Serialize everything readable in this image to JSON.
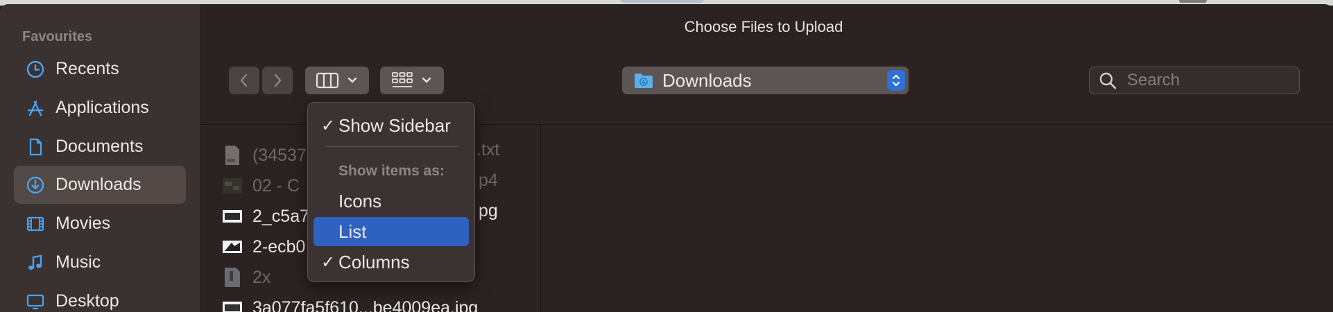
{
  "dialog": {
    "title": "Choose Files to Upload"
  },
  "sidebar": {
    "section_title": "Favourites",
    "items": [
      {
        "label": "Recents",
        "icon": "clock-icon"
      },
      {
        "label": "Applications",
        "icon": "applications-icon"
      },
      {
        "label": "Documents",
        "icon": "document-icon"
      },
      {
        "label": "Downloads",
        "icon": "download-icon",
        "selected": true
      },
      {
        "label": "Movies",
        "icon": "film-icon"
      },
      {
        "label": "Music",
        "icon": "music-note-icon"
      },
      {
        "label": "Desktop",
        "icon": "desktop-icon"
      }
    ]
  },
  "toolbar": {
    "back_icon": "chevron-left-icon",
    "forward_icon": "chevron-right-icon",
    "view_icon": "columns-view-icon",
    "group_icon": "grid-icon",
    "location": "Downloads",
    "search_placeholder": "Search"
  },
  "files": [
    {
      "name": "(34537",
      "suffix": ".txt",
      "dim": true,
      "icon": "text-file-icon"
    },
    {
      "name": "02 - C",
      "suffix": "p4",
      "dim": true,
      "icon": "video-file-icon"
    },
    {
      "name": "2_c5a7",
      "suffix": "pg",
      "dim": false,
      "icon": "image-file-icon"
    },
    {
      "name": "2-ecb0",
      "suffix": "",
      "dim": false,
      "icon": "image-file-icon"
    },
    {
      "name": "2x",
      "suffix": "",
      "dim": true,
      "icon": "archive-file-icon"
    },
    {
      "name": "3a077fa5f610...be4009ea.jpg",
      "suffix": "",
      "dim": false,
      "icon": "image-file-icon"
    }
  ],
  "view_menu": {
    "show_sidebar": "Show Sidebar",
    "show_items_as": "Show items as:",
    "icons": "Icons",
    "list": "List",
    "columns": "Columns",
    "check_glyph": "✓"
  },
  "colors": {
    "accent": "#2f62c0",
    "folder_blue": "#5ab0e8"
  }
}
